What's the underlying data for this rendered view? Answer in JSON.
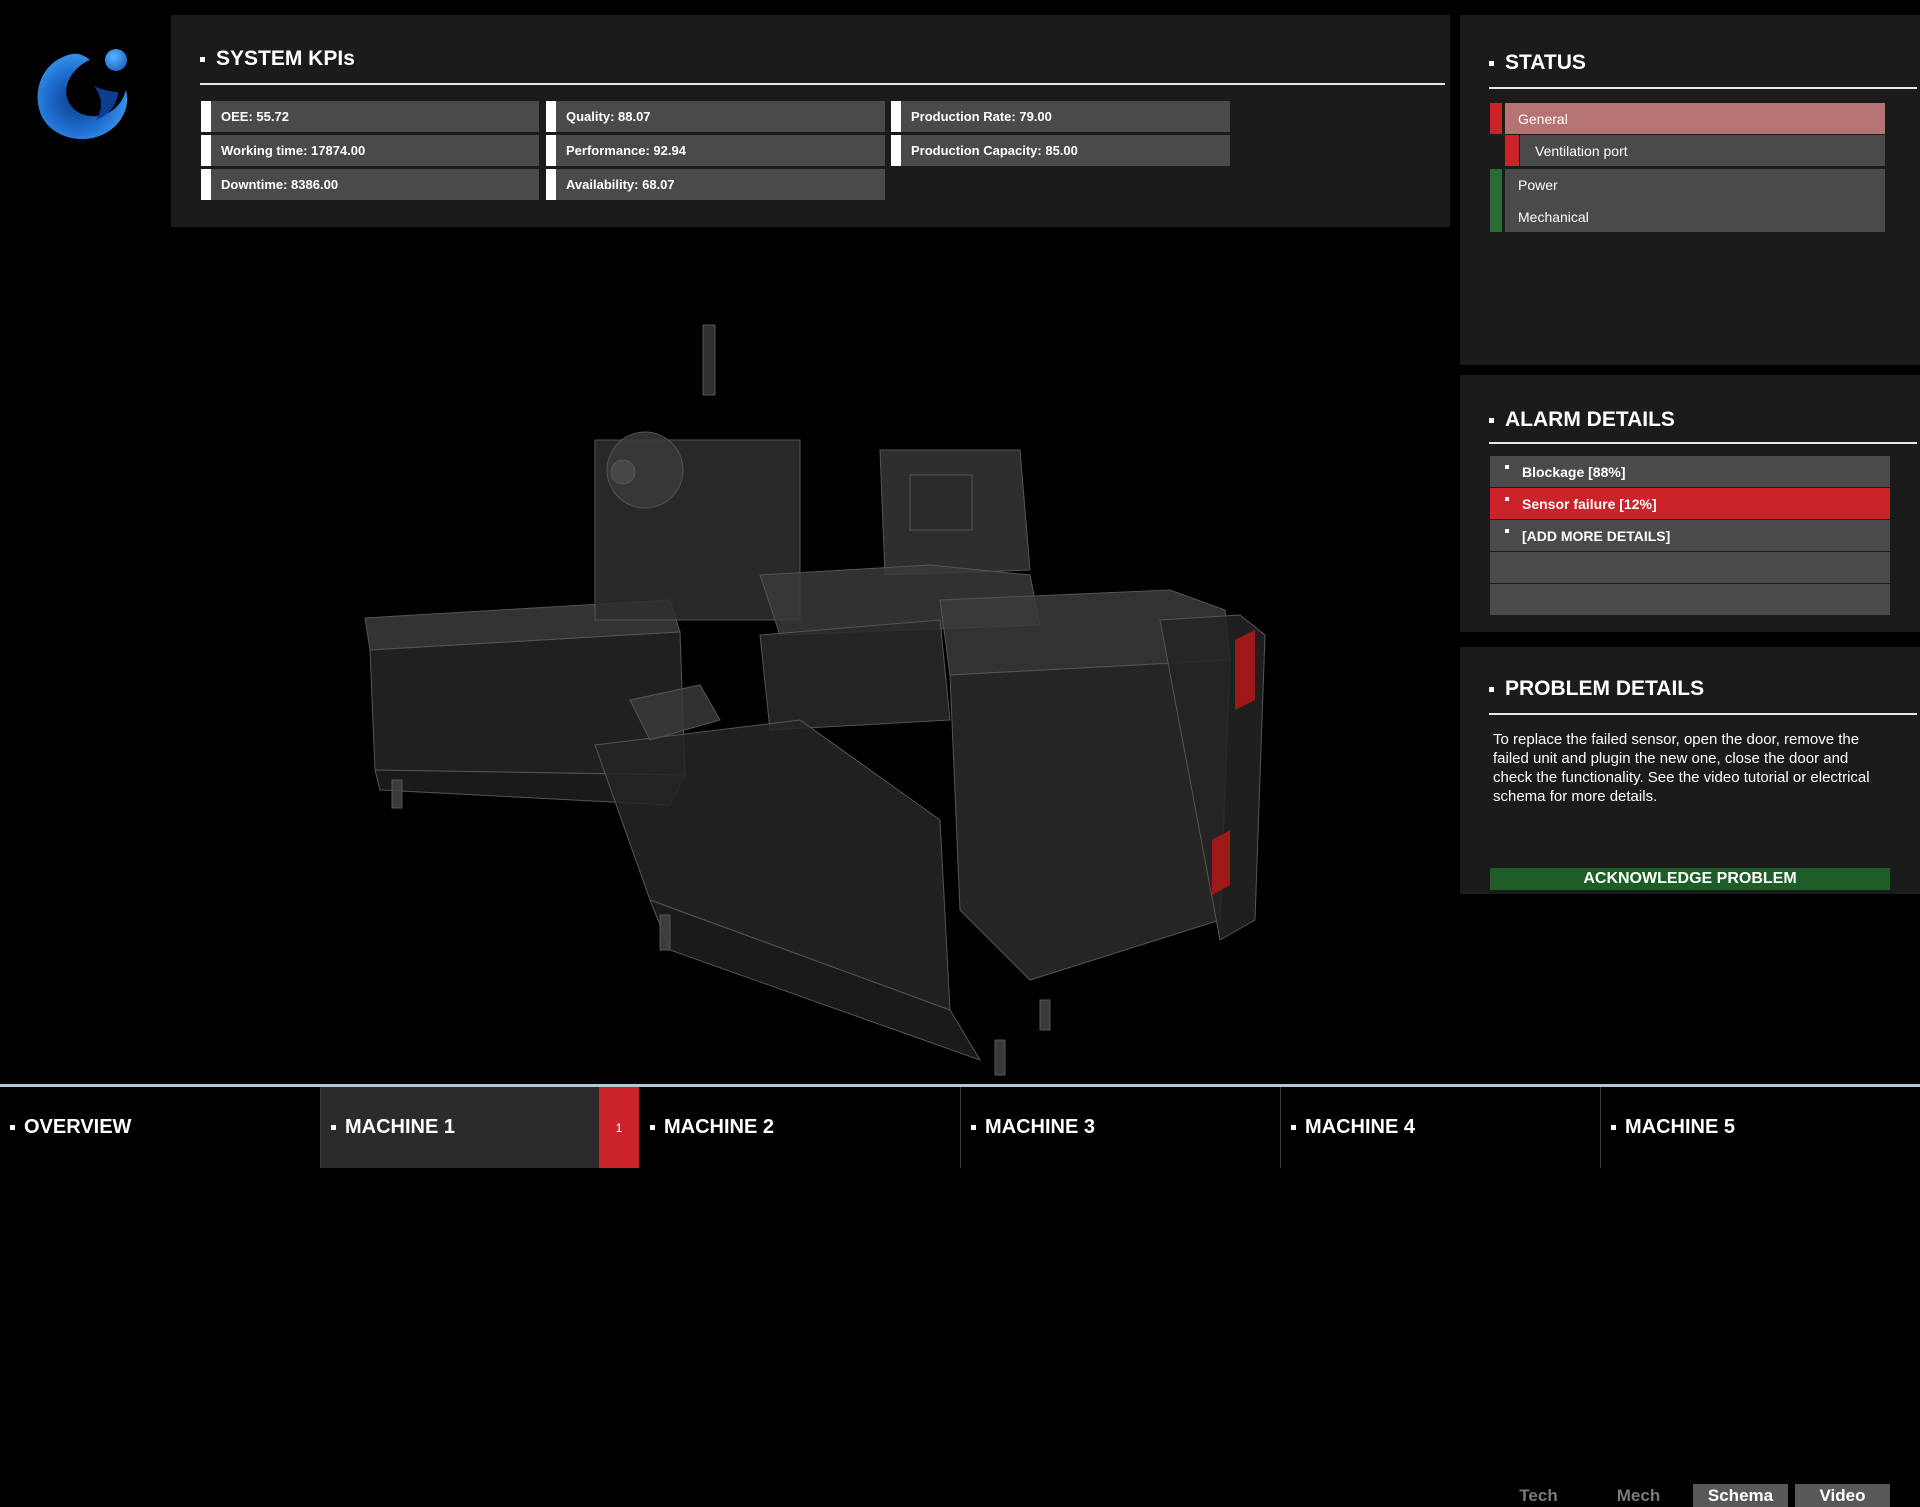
{
  "colors": {
    "alarm_red": "#cc2229",
    "ok_green": "#2a6a34",
    "ack_green": "#1e5d28",
    "panel_bg": "#1b1b1b",
    "cell_bg": "#4a4a4a",
    "logo_blue": "#1f6fd1"
  },
  "logo": {
    "icon": "brand-logo-icon"
  },
  "kpis": {
    "title": "SYSTEM KPIs",
    "cells": [
      [
        "OEE: 55.72",
        "Quality: 88.07",
        "Production Rate: 79.00"
      ],
      [
        "Working time: 17874.00",
        "Performance: 92.94",
        "Production Capacity: 85.00"
      ],
      [
        "Downtime: 8386.00",
        "Availability: 68.07"
      ]
    ]
  },
  "status": {
    "title": "STATUS",
    "items": [
      {
        "label": "General",
        "state": "alarm"
      },
      {
        "label": "Ventilation port",
        "state": "alarm"
      },
      {
        "label": "Power",
        "state": "ok"
      },
      {
        "label": "Mechanical",
        "state": "ok"
      }
    ]
  },
  "alarms": {
    "title": "ALARM DETAILS",
    "items": [
      {
        "label": "Blockage [88%]",
        "active": false
      },
      {
        "label": "Sensor failure [12%]",
        "active": true
      },
      {
        "label": "[ADD MORE DETAILS]",
        "active": false
      }
    ]
  },
  "problem": {
    "title": "PROBLEM DETAILS",
    "text": "To replace the failed sensor, open the door, remove the failed unit and plugin the new one, close the door and check the functionality. See the video tutorial or electrical schema for more details.",
    "buttons": [
      "Tech",
      "Mech",
      "Schema",
      "Video"
    ],
    "ack_label": "ACKNOWLEDGE PROBLEM"
  },
  "tabs": {
    "items": [
      "OVERVIEW",
      "MACHINE 1",
      "MACHINE 2",
      "MACHINE 3",
      "MACHINE 4",
      "MACHINE 5"
    ],
    "active": "MACHINE 1",
    "badge": "1"
  }
}
